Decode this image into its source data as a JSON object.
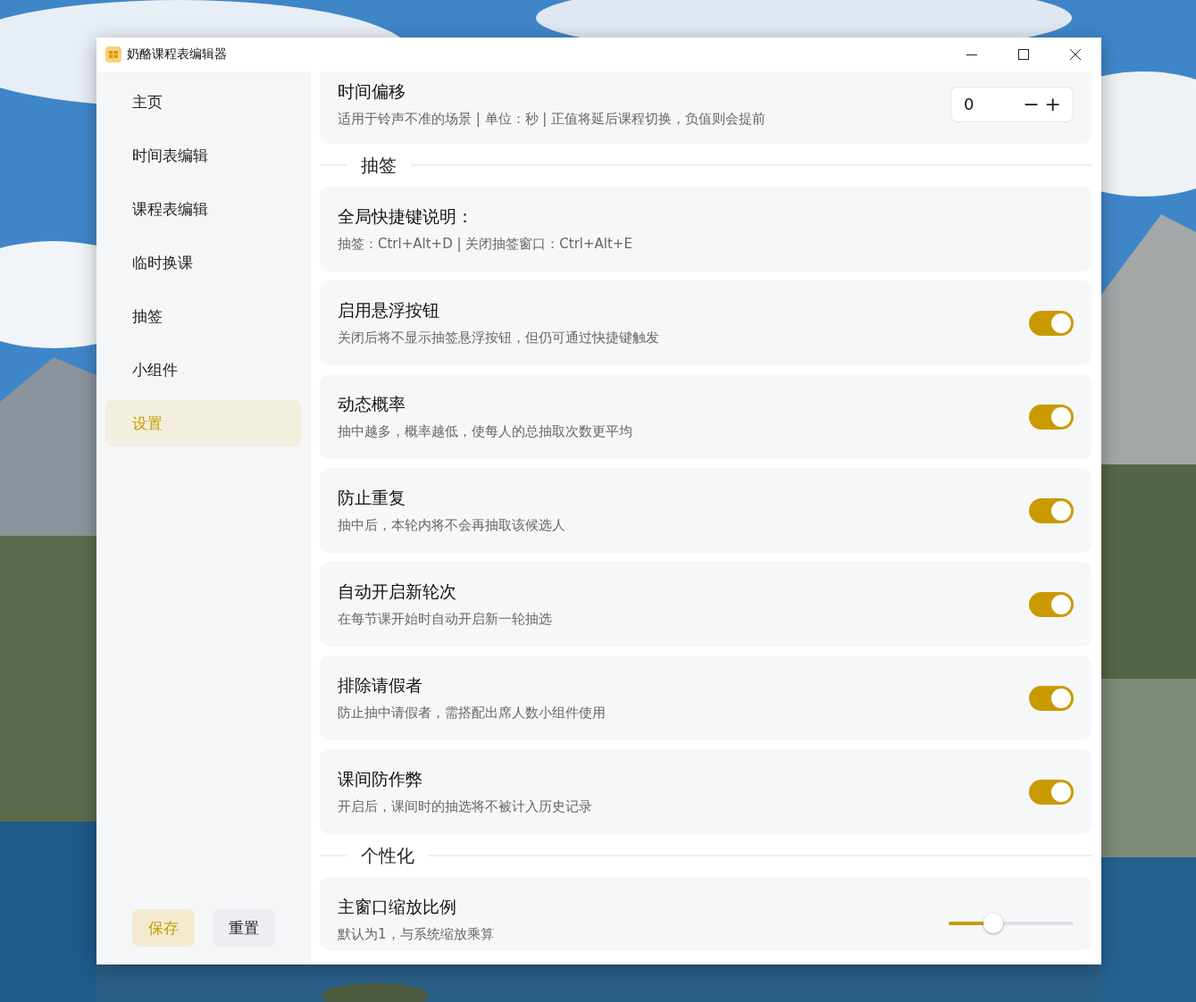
{
  "window": {
    "title": "奶酪课程表编辑器"
  },
  "sidebar": {
    "items": [
      {
        "label": "主页",
        "selected": false
      },
      {
        "label": "时间表编辑",
        "selected": false
      },
      {
        "label": "课程表编辑",
        "selected": false
      },
      {
        "label": "临时换课",
        "selected": false
      },
      {
        "label": "抽签",
        "selected": false
      },
      {
        "label": "小组件",
        "selected": false
      },
      {
        "label": "设置",
        "selected": true
      }
    ],
    "buttons": [
      {
        "label": "保存",
        "kind": "primary"
      },
      {
        "label": "重置",
        "kind": "secondary"
      }
    ]
  },
  "content": [
    {
      "kind": "number",
      "title": "时间偏移",
      "description": "适用于铃声不准的场景 | 单位：秒 | 正值将延后课程切换，负值则会提前",
      "value": "0",
      "minus": "−",
      "plus": "+"
    },
    {
      "kind": "section",
      "title": "抽签"
    },
    {
      "kind": "info",
      "title": "全局快捷键说明：",
      "description": "抽签：Ctrl+Alt+D | 关闭抽签窗口：Ctrl+Alt+E"
    },
    {
      "kind": "switch",
      "title": "启用悬浮按钮",
      "description": "关闭后将不显示抽签悬浮按钮，但仍可通过快捷键触发",
      "on": true
    },
    {
      "kind": "switch",
      "title": "动态概率",
      "description": "抽中越多，概率越低，使每人的总抽取次数更平均",
      "on": true
    },
    {
      "kind": "switch",
      "title": "防止重复",
      "description": "抽中后，本轮内将不会再抽取该候选人",
      "on": true
    },
    {
      "kind": "switch",
      "title": "自动开启新轮次",
      "description": "在每节课开始时自动开启新一轮抽选",
      "on": true
    },
    {
      "kind": "switch",
      "title": "排除请假者",
      "description": "防止抽中请假者，需搭配出席人数小组件使用",
      "on": true
    },
    {
      "kind": "switch",
      "title": "课间防作弊",
      "description": "开启后，课间时的抽选将不被计入历史记录",
      "on": true
    },
    {
      "kind": "section",
      "title": "个性化"
    },
    {
      "kind": "slider",
      "title": "主窗口缩放比例",
      "description": "默认为1，与系统缩放乘算",
      "level": 0.36
    }
  ]
}
